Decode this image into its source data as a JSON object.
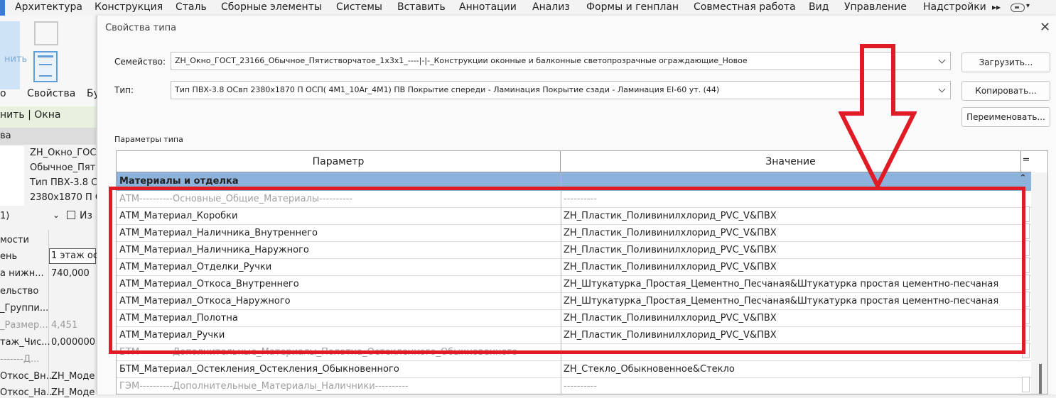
{
  "ribbon": {
    "tabs": [
      "Архитектура",
      "Конструкция",
      "Сталь",
      "Сборные элементы",
      "Системы",
      "Вставить",
      "Аннотации",
      "Анализ",
      "Формы и генплан",
      "Совместная работа",
      "Вид",
      "Управление",
      "Надстройки"
    ],
    "more_icon": "double-chevron-right",
    "view_toggle_icon": "panel-toggle",
    "button_partial_label": "нить",
    "properties_label": "Свойства",
    "left_cut_label": "о",
    "right_cut_label": "Бу"
  },
  "left_panel": {
    "modify_context": "нить | Окна",
    "header": "ва",
    "type_name_lines": [
      "ZH_Окно_ГОС",
      "Обычное_Пят",
      "Тип ПВХ-3.8 С",
      "2380x1870 П С"
    ],
    "selector_label": "1)",
    "edit_type_label": "Из",
    "rows": [
      {
        "label": "мости",
        "value": ""
      },
      {
        "label": "ень",
        "value": "1 этаж ос"
      },
      {
        "label": "а нижн...",
        "value": "740,000"
      },
      {
        "label": "ельство",
        "value": ""
      },
      {
        "label": "_Группи...",
        "value": ""
      },
      {
        "label": "_Размер...",
        "value": "4,451",
        "muted": true
      },
      {
        "label": "таж_Чис...",
        "value": "0,000000"
      },
      {
        "label": "-------Д...",
        "value": "",
        "muted": true
      },
      {
        "label": "Откос_Вн...",
        "value": "ZH_Моде"
      },
      {
        "label": "Откос_На...",
        "value": "ZH_Моде"
      }
    ]
  },
  "dialog": {
    "title": "Свойства типа",
    "family_label": "Семейство:",
    "family_value": "ZH_Окно_ГОСТ_23166_Обычное_Пятистворчатое_1x3x1_----|-|-_Конструкции оконные и балконные светопрозрачные ограждающие_Новое",
    "type_label": "Тип:",
    "type_value": "Тип ПВХ-3.8 ОСвп 2380x1870 П ОСП( 4М1_10Ar_4М1) ПВ Покрытие спереди - Ламинация Покрытие сзади - Ламинация EI-60 ут. (44)",
    "load_button": "Загрузить...",
    "copy_button": "Копировать...",
    "rename_button": "Переименовать...",
    "type_params_label": "Параметры типа",
    "columns": {
      "param": "Параметр",
      "value": "Значение",
      "eq": "="
    },
    "group_title": "Материалы и отделка",
    "rows": [
      {
        "param": "АТМ----------Основные_Общие_Материалы----------",
        "value": "----------",
        "muted": true
      },
      {
        "param": "АТМ_Материал_Коробки",
        "value": "ZH_Пластик_Поливинилхлорид_PVC_V&ПВХ"
      },
      {
        "param": "АТМ_Материал_Наличника_Внутреннего",
        "value": "ZH_Пластик_Поливинилхлорид_PVC_V&ПВХ"
      },
      {
        "param": "АТМ_Материал_Наличника_Наружного",
        "value": "ZH_Пластик_Поливинилхлорид_PVC_V&ПВХ"
      },
      {
        "param": "АТМ_Материал_Отделки_Ручки",
        "value": "ZH_Пластик_Поливинилхлорид_PVC_V&ПВХ"
      },
      {
        "param": "АТМ_Материал_Откоса_Внутреннего",
        "value": "ZH_Штукатурка_Простая_Цементно_Песчаная&Штукатурка простая цементно-песчаная"
      },
      {
        "param": "АТМ_Материал_Откоса_Наружного",
        "value": "ZH_Штукатурка_Простая_Цементно_Песчаная&Штукатурка простая цементно-песчаная"
      },
      {
        "param": "АТМ_Материал_Полотна",
        "value": "ZH_Пластик_Поливинилхлорид_PVC_V&ПВХ"
      },
      {
        "param": "АТМ_Материал_Ручки",
        "value": "ZH_Пластик_Поливинилхлорид_PVC_V&ПВХ"
      },
      {
        "param": "БТМ----------Дополнительные_Материалы_Полотна_Остекленного_Обыкновенного",
        "value": "----------",
        "muted": true
      },
      {
        "param": "БТМ_Материал_Остекления_Остекления_Обыкновенного",
        "value": "ZH_Стекло_Обыкновенное&Стекло"
      },
      {
        "param": "ГЭМ----------Дополнительные_Материалы_Наличники----------",
        "value": "----------",
        "muted": true
      }
    ]
  },
  "annotations": {
    "highlight_color": "#e01b25",
    "arrow_direction": "down"
  }
}
